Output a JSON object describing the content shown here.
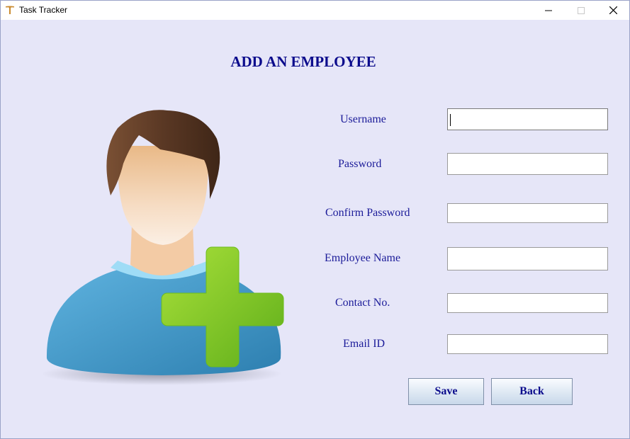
{
  "window": {
    "title": "Task Tracker"
  },
  "page": {
    "title": "ADD AN EMPLOYEE"
  },
  "form": {
    "fields": [
      {
        "label": "Username",
        "value": ""
      },
      {
        "label": "Password",
        "value": ""
      },
      {
        "label": "Confirm Password",
        "value": ""
      },
      {
        "label": "Employee Name",
        "value": ""
      },
      {
        "label": "Contact No.",
        "value": ""
      },
      {
        "label": "Email ID",
        "value": ""
      }
    ]
  },
  "buttons": {
    "save": "Save",
    "back": "Back"
  },
  "icons": {
    "app": "task-tracker-app-icon",
    "avatar": "add-user-illustration",
    "minimize": "minimize-icon",
    "maximize": "maximize-icon",
    "close": "close-icon"
  },
  "colors": {
    "heading": "#0b0b8c",
    "label": "#1b1b99",
    "background": "#e6e6f8",
    "plus": "#7ccc1e",
    "shirt": "#4a9ccf"
  }
}
